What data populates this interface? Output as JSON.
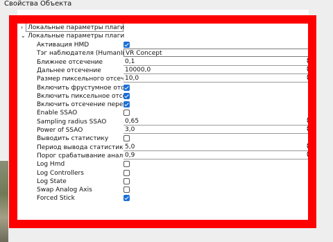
{
  "window": {
    "title": "Свойства Объекта"
  },
  "groups": [
    {
      "label": "Локальные параметры плагина [MASTER",
      "expanded": false
    },
    {
      "label": "Локальные параметры плагина [VR Conc",
      "expanded": true
    }
  ],
  "properties": [
    {
      "label": "Активация HMD",
      "type": "checkbox",
      "checked": true
    },
    {
      "label": "Тэг наблюдателя (HumanInput Tag)",
      "type": "text",
      "value": "VR Concept"
    },
    {
      "label": "Ближнее отсечение",
      "type": "number",
      "value": "0,1"
    },
    {
      "label": "Дальнее отсечение",
      "type": "number",
      "value": "10000,0"
    },
    {
      "label": "Размер пиксельного отсечения",
      "type": "number",
      "value": "10,0"
    },
    {
      "label": "Включить фрустумное отсечение",
      "type": "checkbox",
      "checked": true
    },
    {
      "label": "Включить пиксельное отсечение",
      "type": "checkbox",
      "checked": true
    },
    {
      "label": "Включить отсечение перекрытий",
      "type": "checkbox",
      "checked": true
    },
    {
      "label": "Enable SSAO",
      "type": "checkbox",
      "checked": false
    },
    {
      "label": "Sampling radius SSAO",
      "type": "number",
      "value": "0,65"
    },
    {
      "label": "Power of SSAO",
      "type": "number",
      "value": "3,0"
    },
    {
      "label": "Выводить статистику",
      "type": "checkbox",
      "checked": false
    },
    {
      "label": "Период вывода статистики",
      "type": "number",
      "value": "5,0"
    },
    {
      "label": "Порог срабатывание аналоговых кн",
      "type": "number",
      "value": "0,9"
    },
    {
      "label": "Log Hmd",
      "type": "checkbox",
      "checked": false
    },
    {
      "label": "Log Controllers",
      "type": "checkbox",
      "checked": false
    },
    {
      "label": "Log State",
      "type": "checkbox",
      "checked": false
    },
    {
      "label": "Swap Analog Axis",
      "type": "checkbox",
      "checked": false
    },
    {
      "label": "Forced Stick",
      "type": "checkbox",
      "checked": true
    }
  ],
  "icons": {
    "collapsed": "chevron-right-icon",
    "expanded": "chevron-down-icon",
    "spin": "spin-arrows-icon"
  },
  "colors": {
    "frame": "#ff0000",
    "checkbox_on": "#1a6fd6"
  }
}
